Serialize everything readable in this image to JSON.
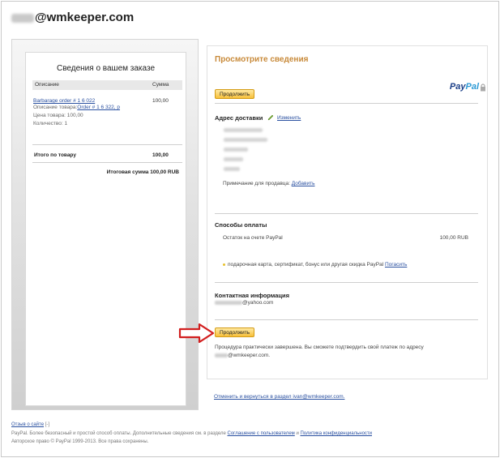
{
  "header": {
    "email_suffix": "@wmkeeper.com"
  },
  "order": {
    "title": "Сведения о вашем заказе",
    "col_description": "Описание",
    "col_amount": "Сумма",
    "item_link": "Barbarage order # 1 6 022",
    "item_amount": "100,00",
    "item_desc_label": "Описание товара:",
    "item_desc_link": "Order # 1 6 322, р",
    "item_price": "Цена товара: 100,00",
    "item_qty": "Количество: 1",
    "subtotal_label": "Итого по товару",
    "subtotal_value": "100,00",
    "total_line": "Итоговая сумма 100,00 RUB"
  },
  "review": {
    "title": "Просмотрите сведения",
    "continue_label": "Продолжить",
    "logo_pay": "Pay",
    "logo_pal": "Pal",
    "shipping_heading": "Адрес доставки",
    "change_link": "Изменить",
    "note_label": "Примечание для продавца:",
    "note_link": "Добавить",
    "payment_heading": "Способы оплаты",
    "balance_label": "Остаток на счете PayPal",
    "balance_value": "100,00 RUB",
    "gift_text": "подарочная карта, сертификат, бонус или другая скидка PayPal",
    "gift_link": "Погасить",
    "contact_heading": "Контактная информация",
    "contact_email_suffix": "@yahoo.com",
    "continue_label_2": "Продолжить",
    "final_line1": "Процедура практически завершена. Вы сможете подтвердить свой платеж по адресу",
    "final_line2_suffix": "@wmkeeper.com.",
    "cancel_link": "Отменить и вернуться в раздел ivan@wmkeeper.com."
  },
  "footer": {
    "feedback_link": "Отзыв о сайте",
    "feedback_mark": "[-]",
    "line2_text": "PayPal. Более безопасный и простой способ оплаты. Дополнительные сведения см. в разделе",
    "user_agreement_link": "Соглашение с пользователем",
    "and_text": "и",
    "privacy_link": "Политика конфиденциальности",
    "copyright": "Авторское право © PayPal 1999-2013. Все права сохранены."
  }
}
